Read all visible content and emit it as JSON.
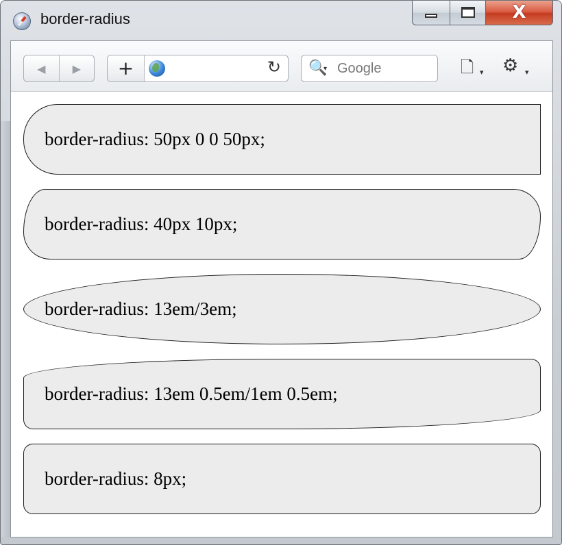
{
  "window": {
    "title": "border-radius",
    "caption_close": "X"
  },
  "toolbar": {
    "back_glyph": "◀",
    "forward_glyph": "▶",
    "new_tab_glyph": "+",
    "reload_glyph": "↻",
    "search_placeholder": "Google",
    "page_menu_glyph": "🗋",
    "tools_menu_glyph": "⚙",
    "dropdown_glyph": "▾",
    "search_glyph": "🔍"
  },
  "content": {
    "boxes": [
      {
        "label": "border-radius: 50px 0 0 50px;"
      },
      {
        "label": "border-radius: 40px 10px;"
      },
      {
        "label": "border-radius: 13em/3em;"
      },
      {
        "label": "border-radius: 13em 0.5em/1em 0.5em;"
      },
      {
        "label": "border-radius: 8px;"
      }
    ]
  }
}
